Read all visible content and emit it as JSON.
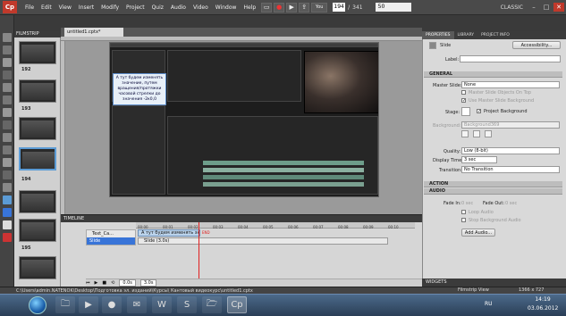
{
  "menu": {
    "items": [
      "File",
      "Edit",
      "View",
      "Insert",
      "Modify",
      "Project",
      "Quiz",
      "Audio",
      "Video",
      "Window",
      "Help"
    ],
    "slide_current": "194",
    "slide_total": "341",
    "zoom": "50",
    "workspace": "CLASSIC"
  },
  "filmstrip": {
    "title": "FILMSTRIP",
    "numbers": [
      "192",
      "193",
      "194",
      "195"
    ]
  },
  "document": {
    "tab": "untitled1.cptx*",
    "tooltip_text": "А тут будем изменять значение, путем вращения/протяжки часовой стрелки до значения -2к0,0"
  },
  "timeline": {
    "title": "TIMELINE",
    "row1_label": "Text_Ca...",
    "row2_label": "Slide",
    "bar1_text": "А тут будем изменять зна",
    "bar2_text": "Slide (3.0s)",
    "ticks": [
      "00:00",
      "00:01",
      "00:02",
      "00:03",
      "00:04",
      "00:05",
      "00:06",
      "00:07",
      "00:08",
      "00:09",
      "00:10"
    ],
    "time1": "0.0s",
    "time2": "3.0s",
    "end_marker": "END"
  },
  "properties": {
    "tabs": [
      "PROPERTIES",
      "LIBRARY",
      "PROJECT INFO"
    ],
    "type_label": "Slide",
    "accessibility_btn": "Accessibility...",
    "label_field": "Label:",
    "section_general": "GENERAL",
    "master_slide_label": "Master Slide:",
    "master_slide_value": "None",
    "chk_master_objects": "Master Slide Objects On Top",
    "chk_use_master_bg": "Use Master Slide Background",
    "stage_label": "Stage:",
    "chk_project_bg": "Project Background",
    "background_label": "Background:",
    "background_value": "Background369",
    "quality_label": "Quality:",
    "quality_value": "Low (8-bit)",
    "display_time_label": "Display Time:",
    "display_time_value": "3 sec",
    "transition_label": "Transition:",
    "transition_value": "No Transition",
    "section_action": "ACTION",
    "section_audio": "AUDIO",
    "fade_in_label": "Fade In:",
    "fade_in_value": "0 sec",
    "fade_out_label": "Fade Out:",
    "fade_out_value": "0 sec",
    "chk_loop": "Loop Audio",
    "chk_stop_bg": "Stop Background Audio",
    "add_audio_btn": "Add Audio...",
    "widgets": "WIDGETS"
  },
  "status": {
    "path": "C:\\Users\\admin.NATENOK\\Desktop\\Подготовка эл. изданий\\Курсы\\ Кантовый видеокурс\\untitled1.cptx",
    "view": "Filmstrip View",
    "size": "1366 x 727"
  },
  "taskbar": {
    "lang": "RU",
    "time": "14:19",
    "date": "03.06.2012"
  },
  "colors": {
    "accent": "#3874d8",
    "playhead": "#e02020",
    "logo": "#c0392b"
  }
}
